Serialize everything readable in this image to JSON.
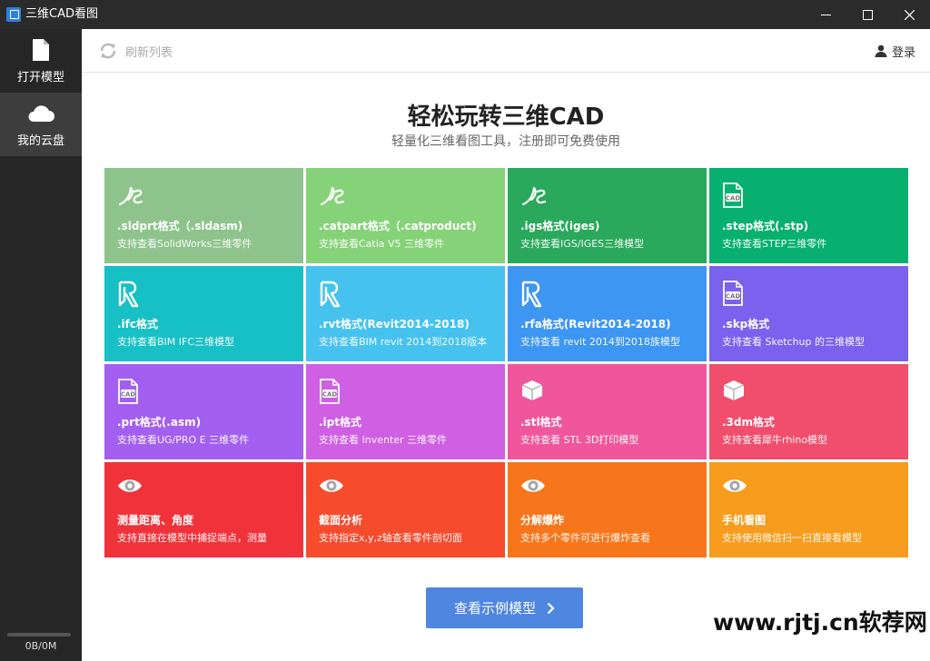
{
  "window": {
    "title": "三维CAD看图",
    "app_icon": "app-icon"
  },
  "sidebar": {
    "items": [
      {
        "label": "打开模型",
        "icon": "file-icon"
      },
      {
        "label": "我的云盘",
        "icon": "cloud-icon"
      }
    ],
    "storage": {
      "text": "0B/0M",
      "used_fraction": 0
    }
  },
  "toolbar": {
    "refresh_label": "刷新列表",
    "login_label": "登录"
  },
  "hero": {
    "title": "轻松玩转三维CAD",
    "subtitle": "轻量化三维看图工具，注册即可免费使用"
  },
  "tiles": [
    {
      "title": ".sldprt格式（.sldasm)",
      "desc": "支持查看SolidWorks三维零件",
      "icon": "ds-logo-icon",
      "color": "#8ec48c"
    },
    {
      "title": ".catpart格式（.catproduct)",
      "desc": "支持查看Catia V5 三维零件",
      "icon": "ds-logo-icon",
      "color": "#86d279"
    },
    {
      "title": ".igs格式(iges)",
      "desc": "支持查看IGS/IGES三维模型",
      "icon": "ds-logo-icon",
      "color": "#2aa85b"
    },
    {
      "title": ".step格式(.stp)",
      "desc": "支持查看STEP三维零件",
      "icon": "cad-file-icon",
      "color": "#07b06e"
    },
    {
      "title": ".ifc格式",
      "desc": "支持查看BIM IFC三维模型",
      "icon": "revit-icon",
      "color": "#17c0c4"
    },
    {
      "title": ".rvt格式(Revit2014-2018)",
      "desc": "支持查看BIM revit 2014到2018版本",
      "icon": "revit-icon",
      "color": "#46c2ef"
    },
    {
      "title": ".rfa格式(Revit2014-2018)",
      "desc": "支持查看 revit 2014到2018族模型",
      "icon": "revit-icon",
      "color": "#3e96f3"
    },
    {
      "title": ".skp格式",
      "desc": "支持查看 Sketchup 的三维模型",
      "icon": "cad-file-icon",
      "color": "#7a61ee"
    },
    {
      "title": ".prt格式(.asm)",
      "desc": "支持查看UG/PRO E 三维零件",
      "icon": "cad-file-icon",
      "color": "#a35ff0"
    },
    {
      "title": ".ipt格式",
      "desc": "支持查看 Inventer 三维零件",
      "icon": "cad-file-icon",
      "color": "#cf5fe3"
    },
    {
      "title": ".stl格式",
      "desc": "支持查看 STL 3D打印模型",
      "icon": "cube-icon",
      "color": "#f0569b"
    },
    {
      "title": ".3dm格式",
      "desc": "支持查看犀牛rhino模型",
      "icon": "cube-icon",
      "color": "#f04e6c"
    },
    {
      "title": "测量距离、角度",
      "desc": "支持直接在模型中捕捉端点，测量",
      "icon": "eye-icon",
      "color": "#f0333b"
    },
    {
      "title": "截面分析",
      "desc": "支持指定x,y,z轴查看零件剖切面",
      "icon": "eye-icon",
      "color": "#f64b2d"
    },
    {
      "title": "分解爆炸",
      "desc": "支持多个零件可进行爆炸查看",
      "icon": "eye-icon",
      "color": "#f7761c"
    },
    {
      "title": "手机看图",
      "desc": "支持使用微信扫一扫直接看模型",
      "icon": "eye-icon",
      "color": "#f79c1c"
    }
  ],
  "cta": {
    "label": "查看示例模型"
  },
  "watermark": {
    "text": "www.rjtj.cn软荐网"
  }
}
